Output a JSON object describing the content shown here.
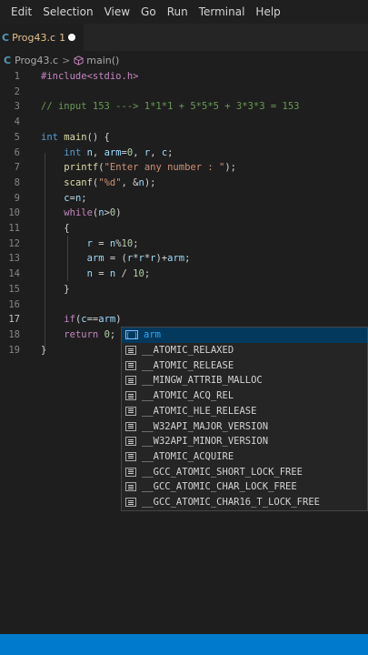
{
  "menubar": {
    "items": [
      "Edit",
      "Selection",
      "View",
      "Go",
      "Run",
      "Terminal",
      "Help"
    ]
  },
  "tab": {
    "icon": "C",
    "filename": "Prog43.c",
    "problem_count": "1"
  },
  "breadcrumb": {
    "icon": "C",
    "file": "Prog43.c",
    "separator": ">",
    "symbol": "main()",
    "symbol_icon": "cube-icon"
  },
  "editor": {
    "lines": [
      {
        "num": "1",
        "tokens": [
          {
            "t": "#include<stdio.h>",
            "c": "pre"
          }
        ]
      },
      {
        "num": "2",
        "tokens": []
      },
      {
        "num": "3",
        "tokens": [
          {
            "t": "// input 153 ---> 1*1*1 + 5*5*5 + 3*3*3 = 153",
            "c": "com"
          }
        ]
      },
      {
        "num": "4",
        "tokens": []
      },
      {
        "num": "5",
        "tokens": [
          {
            "t": "int ",
            "c": "kw"
          },
          {
            "t": "main",
            "c": "fn"
          },
          {
            "t": "() {",
            "c": "def"
          }
        ]
      },
      {
        "num": "6",
        "tokens": [
          {
            "t": "    ",
            "c": "def"
          },
          {
            "t": "int ",
            "c": "kw"
          },
          {
            "t": "n",
            "c": "var"
          },
          {
            "t": ", ",
            "c": "def"
          },
          {
            "t": "arm",
            "c": "var"
          },
          {
            "t": "=",
            "c": "def"
          },
          {
            "t": "0",
            "c": "num"
          },
          {
            "t": ", ",
            "c": "def"
          },
          {
            "t": "r",
            "c": "var"
          },
          {
            "t": ", ",
            "c": "def"
          },
          {
            "t": "c",
            "c": "var"
          },
          {
            "t": ";",
            "c": "def"
          }
        ]
      },
      {
        "num": "7",
        "tokens": [
          {
            "t": "    ",
            "c": "def"
          },
          {
            "t": "printf",
            "c": "fn"
          },
          {
            "t": "(",
            "c": "def"
          },
          {
            "t": "\"Enter any number : \"",
            "c": "str"
          },
          {
            "t": ");",
            "c": "def"
          }
        ]
      },
      {
        "num": "8",
        "tokens": [
          {
            "t": "    ",
            "c": "def"
          },
          {
            "t": "scanf",
            "c": "fn"
          },
          {
            "t": "(",
            "c": "def"
          },
          {
            "t": "\"%d\"",
            "c": "str"
          },
          {
            "t": ", &",
            "c": "def"
          },
          {
            "t": "n",
            "c": "var"
          },
          {
            "t": ");",
            "c": "def"
          }
        ]
      },
      {
        "num": "9",
        "tokens": [
          {
            "t": "    ",
            "c": "def"
          },
          {
            "t": "c",
            "c": "var"
          },
          {
            "t": "=",
            "c": "def"
          },
          {
            "t": "n",
            "c": "var"
          },
          {
            "t": ";",
            "c": "def"
          }
        ]
      },
      {
        "num": "10",
        "tokens": [
          {
            "t": "    ",
            "c": "def"
          },
          {
            "t": "while",
            "c": "ctl"
          },
          {
            "t": "(",
            "c": "def"
          },
          {
            "t": "n",
            "c": "var"
          },
          {
            "t": ">",
            "c": "def"
          },
          {
            "t": "0",
            "c": "num"
          },
          {
            "t": ")",
            "c": "def"
          }
        ]
      },
      {
        "num": "11",
        "tokens": [
          {
            "t": "    {",
            "c": "def"
          }
        ]
      },
      {
        "num": "12",
        "tokens": [
          {
            "t": "        ",
            "c": "def"
          },
          {
            "t": "r",
            "c": "var"
          },
          {
            "t": " = ",
            "c": "def"
          },
          {
            "t": "n",
            "c": "var"
          },
          {
            "t": "%",
            "c": "def"
          },
          {
            "t": "10",
            "c": "num"
          },
          {
            "t": ";",
            "c": "def"
          }
        ]
      },
      {
        "num": "13",
        "tokens": [
          {
            "t": "        ",
            "c": "def"
          },
          {
            "t": "arm",
            "c": "var"
          },
          {
            "t": " = (",
            "c": "def"
          },
          {
            "t": "r",
            "c": "var"
          },
          {
            "t": "*",
            "c": "def"
          },
          {
            "t": "r",
            "c": "var"
          },
          {
            "t": "*",
            "c": "def"
          },
          {
            "t": "r",
            "c": "var"
          },
          {
            "t": ")+",
            "c": "def"
          },
          {
            "t": "arm",
            "c": "var"
          },
          {
            "t": ";",
            "c": "def"
          }
        ]
      },
      {
        "num": "14",
        "tokens": [
          {
            "t": "        ",
            "c": "def"
          },
          {
            "t": "n",
            "c": "var"
          },
          {
            "t": " = ",
            "c": "def"
          },
          {
            "t": "n",
            "c": "var"
          },
          {
            "t": " / ",
            "c": "def"
          },
          {
            "t": "10",
            "c": "num"
          },
          {
            "t": ";",
            "c": "def"
          }
        ]
      },
      {
        "num": "15",
        "tokens": [
          {
            "t": "    }",
            "c": "def"
          }
        ]
      },
      {
        "num": "16",
        "tokens": []
      },
      {
        "num": "17",
        "tokens": [
          {
            "t": "    ",
            "c": "def"
          },
          {
            "t": "if",
            "c": "ctl"
          },
          {
            "t": "(",
            "c": "def"
          },
          {
            "t": "c",
            "c": "var"
          },
          {
            "t": "==",
            "c": "def"
          },
          {
            "t": "arm",
            "c": "var"
          },
          {
            "t": ")",
            "c": "def"
          }
        ]
      },
      {
        "num": "18",
        "tokens": [
          {
            "t": "    ",
            "c": "def"
          },
          {
            "t": "return ",
            "c": "ctl"
          },
          {
            "t": "0",
            "c": "num"
          },
          {
            "t": ";",
            "c": "def"
          }
        ]
      },
      {
        "num": "19",
        "tokens": [
          {
            "t": "}",
            "c": "def"
          }
        ]
      }
    ],
    "active_line": "17"
  },
  "suggest": {
    "items": [
      {
        "label": "arm",
        "kind": "variable",
        "selected": true
      },
      {
        "label": "__ATOMIC_RELAXED",
        "kind": "constant"
      },
      {
        "label": "__ATOMIC_RELEASE",
        "kind": "constant"
      },
      {
        "label": "__MINGW_ATTRIB_MALLOC",
        "kind": "constant"
      },
      {
        "label": "__ATOMIC_ACQ_REL",
        "kind": "constant"
      },
      {
        "label": "__ATOMIC_HLE_RELEASE",
        "kind": "constant"
      },
      {
        "label": "__W32API_MAJOR_VERSION",
        "kind": "constant"
      },
      {
        "label": "__W32API_MINOR_VERSION",
        "kind": "constant"
      },
      {
        "label": "__ATOMIC_ACQUIRE",
        "kind": "constant"
      },
      {
        "label": "__GCC_ATOMIC_SHORT_LOCK_FREE",
        "kind": "constant"
      },
      {
        "label": "__GCC_ATOMIC_CHAR_LOCK_FREE",
        "kind": "constant"
      },
      {
        "label": "__GCC_ATOMIC_CHAR16_T_LOCK_FREE",
        "kind": "constant"
      }
    ]
  },
  "colors": {
    "statusbar": "#007acc",
    "editor_bg": "#1e1e1e",
    "tab_modified": "#e2c08d"
  }
}
